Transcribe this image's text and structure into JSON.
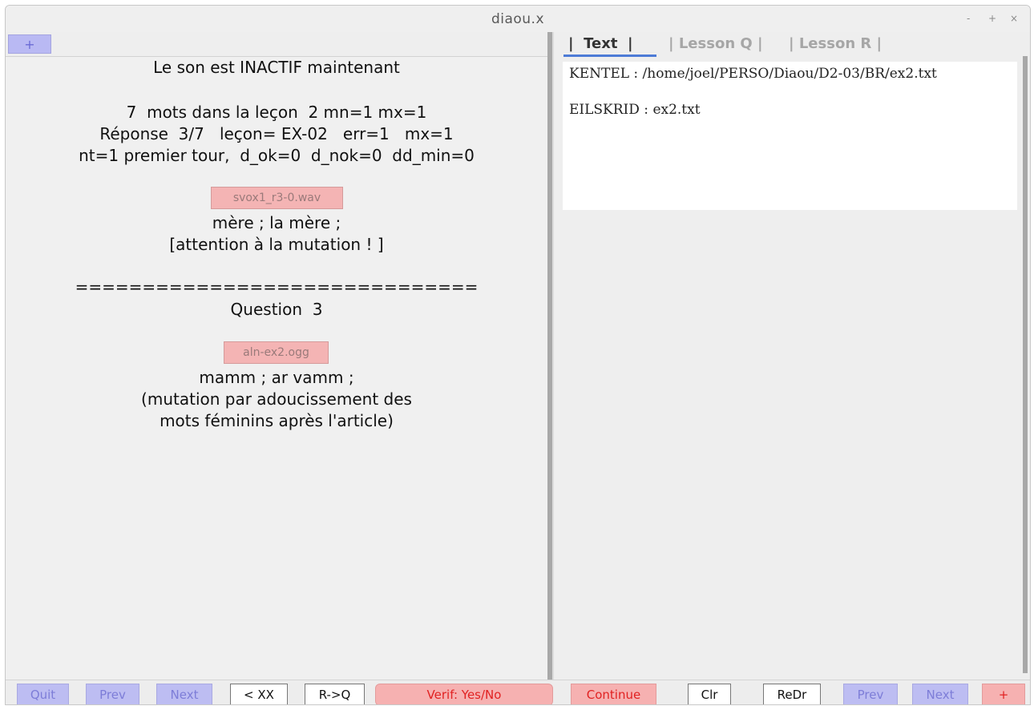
{
  "window": {
    "title": "diaou.x",
    "controls": [
      "-",
      "+",
      "×"
    ]
  },
  "left": {
    "plus_label": "+",
    "lines": [
      "Le son est INACTIF maintenant",
      "7  mots dans la leçon  2 mn=1 mx=1",
      "Réponse  3/7   leçon= EX-02   err=1   mx=1",
      "nt=1 premier tour,  d_ok=0  d_nok=0  dd_min=0",
      "mère ; la mère ;",
      "[attention à la mutation ! ]",
      "==============================",
      "Question  3",
      "mamm ; ar vamm ;",
      "(mutation par adoucissement des",
      "mots féminins après l'article)"
    ],
    "audio1": "svox1_r3-0.wav",
    "audio2": "aln-ex2.ogg"
  },
  "right": {
    "tabs": [
      {
        "label": "|  Text  |",
        "active": true
      },
      {
        "label": "| Lesson Q |",
        "active": false
      },
      {
        "label": "| Lesson R |",
        "active": false
      }
    ],
    "text_lines": [
      "KENTEL : /home/joel/PERSO/Diaou/D2-03/BR/ex2.txt",
      "EILSKRID : ex2.txt"
    ]
  },
  "buttons": {
    "quit": "Quit",
    "prev_left": "Prev",
    "next_left": "Next",
    "back_xx": "< XX",
    "r_to_q": "R->Q",
    "verif": "Verif: Yes/No",
    "continue": "Continue",
    "clr": "Clr",
    "redr": "ReDr",
    "prev_right": "Prev",
    "next_right": "Next",
    "plus": "+"
  },
  "colors": {
    "blue_button": "#bdbdf2",
    "red_button": "#f6b1b1",
    "red_text": "#e12222",
    "tab_accent": "#4d7bd6"
  }
}
